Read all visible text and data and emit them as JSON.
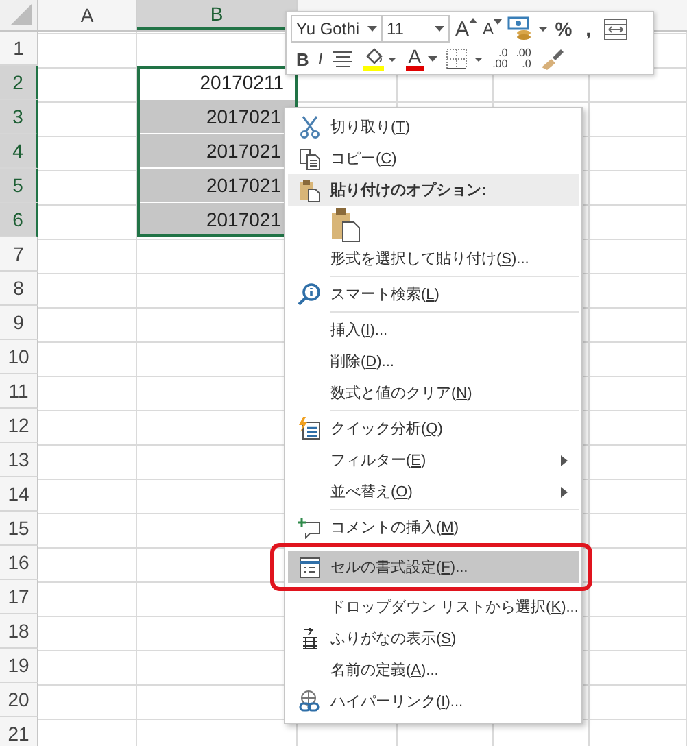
{
  "sheet": {
    "columns": [
      {
        "label": "A",
        "selected": false
      },
      {
        "label": "B",
        "selected": true
      }
    ],
    "rows": [
      {
        "label": "1",
        "selected": false
      },
      {
        "label": "2",
        "selected": true,
        "active": true,
        "cell_b": "20170211"
      },
      {
        "label": "3",
        "selected": true,
        "active": false,
        "cell_b": "2017021"
      },
      {
        "label": "4",
        "selected": true,
        "active": false,
        "cell_b": "2017021"
      },
      {
        "label": "5",
        "selected": true,
        "active": false,
        "cell_b": "2017021"
      },
      {
        "label": "6",
        "selected": true,
        "active": false,
        "cell_b": "2017021"
      },
      {
        "label": "7",
        "selected": false
      },
      {
        "label": "8",
        "selected": false
      },
      {
        "label": "9",
        "selected": false
      },
      {
        "label": "10",
        "selected": false
      },
      {
        "label": "11",
        "selected": false
      },
      {
        "label": "12",
        "selected": false
      },
      {
        "label": "13",
        "selected": false
      },
      {
        "label": "14",
        "selected": false
      },
      {
        "label": "15",
        "selected": false
      },
      {
        "label": "16",
        "selected": false
      },
      {
        "label": "17",
        "selected": false
      },
      {
        "label": "18",
        "selected": false
      },
      {
        "label": "19",
        "selected": false
      },
      {
        "label": "20",
        "selected": false
      },
      {
        "label": "21",
        "selected": false
      }
    ]
  },
  "mini_toolbar": {
    "font": "Yu Gothi",
    "size": "11",
    "row1": [
      {
        "kind": "grow-font",
        "label": "A"
      },
      {
        "kind": "shrink-font",
        "label": "A"
      },
      {
        "kind": "accounting"
      },
      {
        "kind": "text",
        "label": "%"
      },
      {
        "kind": "text",
        "label": ","
      },
      {
        "kind": "wrap"
      }
    ],
    "row2": [
      {
        "kind": "bold",
        "label": "B"
      },
      {
        "kind": "italic",
        "label": "I"
      },
      {
        "kind": "align"
      },
      {
        "kind": "fill",
        "color": "#ffff00"
      },
      {
        "kind": "font-color",
        "label": "A",
        "color": "#e00000"
      },
      {
        "kind": "borders"
      },
      {
        "kind": "decimal-more",
        "top": ".0",
        "bottom": ".00"
      },
      {
        "kind": "decimal-less",
        "top": ".00",
        "bottom": ".0"
      },
      {
        "kind": "painter"
      }
    ]
  },
  "context_menu": {
    "items": [
      {
        "kind": "cut",
        "prefix": "切り取り(",
        "accel": "T",
        "suffix": ")",
        "selected": false,
        "outlined": false
      },
      {
        "kind": "copy",
        "prefix": "コピー(",
        "accel": "C",
        "suffix": ")",
        "selected": false,
        "outlined": false
      },
      {
        "kind": "paste-header",
        "prefix": "貼り付けのオプション:",
        "selected": false,
        "outlined": false
      },
      {
        "kind": "paste-option",
        "selected": false,
        "outlined": false
      },
      {
        "kind": "item",
        "prefix": "形式を選択して貼り付け(",
        "accel": "S",
        "suffix": ")...",
        "selected": false,
        "outlined": false
      },
      {
        "kind": "separator"
      },
      {
        "kind": "smart-search",
        "prefix": "スマート検索(",
        "accel": "L",
        "suffix": ")",
        "selected": false,
        "outlined": false
      },
      {
        "kind": "separator"
      },
      {
        "kind": "item",
        "prefix": "挿入(",
        "accel": "I",
        "suffix": ")...",
        "selected": false,
        "outlined": false
      },
      {
        "kind": "item",
        "prefix": "削除(",
        "accel": "D",
        "suffix": ")...",
        "selected": false,
        "outlined": false
      },
      {
        "kind": "item",
        "prefix": "数式と値のクリア(",
        "accel": "N",
        "suffix": ")",
        "selected": false,
        "outlined": false
      },
      {
        "kind": "separator"
      },
      {
        "kind": "quick-analysis",
        "prefix": "クイック分析(",
        "accel": "Q",
        "suffix": ")",
        "selected": false,
        "outlined": false
      },
      {
        "kind": "submenu",
        "prefix": "フィルター(",
        "accel": "E",
        "suffix": ")",
        "selected": false,
        "outlined": false
      },
      {
        "kind": "submenu",
        "prefix": "並べ替え(",
        "accel": "O",
        "suffix": ")",
        "selected": false,
        "outlined": false
      },
      {
        "kind": "separator"
      },
      {
        "kind": "comment",
        "prefix": "コメントの挿入(",
        "accel": "M",
        "suffix": ")",
        "selected": false,
        "outlined": false
      },
      {
        "kind": "format-cells",
        "prefix": "セルの書式設定(",
        "accel": "F",
        "suffix": ")...",
        "selected": true,
        "outlined": true
      },
      {
        "kind": "item",
        "prefix": "ドロップダウン リストから選択(",
        "accel": "K",
        "suffix": ")...",
        "selected": false,
        "outlined": false
      },
      {
        "kind": "furigana",
        "prefix": "ふりがなの表示(",
        "accel": "S",
        "suffix": ")",
        "selected": false,
        "outlined": false
      },
      {
        "kind": "item",
        "prefix": "名前の定義(",
        "accel": "A",
        "suffix": ")...",
        "selected": false,
        "outlined": false
      },
      {
        "kind": "hyperlink",
        "prefix": "ハイパーリンク(",
        "accel": "I",
        "suffix": ")...",
        "selected": false,
        "outlined": false
      }
    ]
  }
}
